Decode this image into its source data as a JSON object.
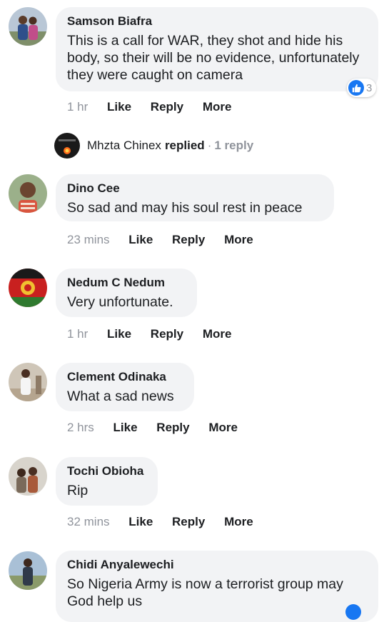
{
  "comments": [
    {
      "author": "Samson Biafra",
      "text": "This is a call for WAR, they shot and hide his body, so their will be no evidence, unfortunately they were caught on camera",
      "time": "1 hr",
      "reaction_count": "3"
    },
    {
      "author": "Dino Cee",
      "text": "So sad and may his soul rest in peace",
      "time": "23 mins"
    },
    {
      "author": "Nedum C Nedum",
      "text": "Very unfortunate.",
      "time": "1 hr"
    },
    {
      "author": "Clement Odinaka",
      "text": "What a sad news",
      "time": "2 hrs"
    },
    {
      "author": "Tochi Obioha",
      "text": "Rip",
      "time": "32 mins"
    },
    {
      "author": "Chidi Anyalewechi",
      "text": "So Nigeria Army is now a terrorist group may God help us"
    }
  ],
  "reply_summary": {
    "name": "Mhzta Chinex",
    "verb": "replied",
    "separator": "·",
    "count": "1 reply"
  },
  "actions": {
    "like": "Like",
    "reply": "Reply",
    "more": "More"
  },
  "colors": {
    "bubble": "#f2f3f5",
    "muted": "#90949c",
    "like_blue": "#1877f2",
    "text": "#1c1e21"
  }
}
